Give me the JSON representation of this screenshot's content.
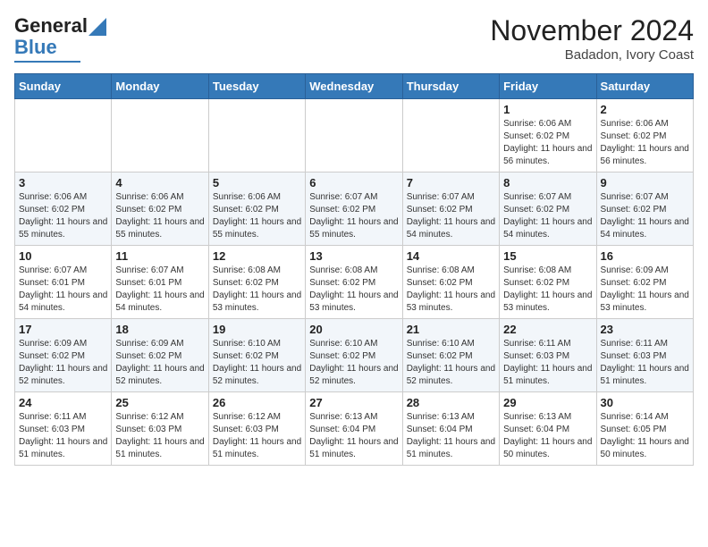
{
  "header": {
    "logo_line1": "General",
    "logo_line2": "Blue",
    "month_title": "November 2024",
    "location": "Badadon, Ivory Coast"
  },
  "weekdays": [
    "Sunday",
    "Monday",
    "Tuesday",
    "Wednesday",
    "Thursday",
    "Friday",
    "Saturday"
  ],
  "weeks": [
    [
      {
        "day": "",
        "info": ""
      },
      {
        "day": "",
        "info": ""
      },
      {
        "day": "",
        "info": ""
      },
      {
        "day": "",
        "info": ""
      },
      {
        "day": "",
        "info": ""
      },
      {
        "day": "1",
        "info": "Sunrise: 6:06 AM\nSunset: 6:02 PM\nDaylight: 11 hours and 56 minutes."
      },
      {
        "day": "2",
        "info": "Sunrise: 6:06 AM\nSunset: 6:02 PM\nDaylight: 11 hours and 56 minutes."
      }
    ],
    [
      {
        "day": "3",
        "info": "Sunrise: 6:06 AM\nSunset: 6:02 PM\nDaylight: 11 hours and 55 minutes."
      },
      {
        "day": "4",
        "info": "Sunrise: 6:06 AM\nSunset: 6:02 PM\nDaylight: 11 hours and 55 minutes."
      },
      {
        "day": "5",
        "info": "Sunrise: 6:06 AM\nSunset: 6:02 PM\nDaylight: 11 hours and 55 minutes."
      },
      {
        "day": "6",
        "info": "Sunrise: 6:07 AM\nSunset: 6:02 PM\nDaylight: 11 hours and 55 minutes."
      },
      {
        "day": "7",
        "info": "Sunrise: 6:07 AM\nSunset: 6:02 PM\nDaylight: 11 hours and 54 minutes."
      },
      {
        "day": "8",
        "info": "Sunrise: 6:07 AM\nSunset: 6:02 PM\nDaylight: 11 hours and 54 minutes."
      },
      {
        "day": "9",
        "info": "Sunrise: 6:07 AM\nSunset: 6:02 PM\nDaylight: 11 hours and 54 minutes."
      }
    ],
    [
      {
        "day": "10",
        "info": "Sunrise: 6:07 AM\nSunset: 6:01 PM\nDaylight: 11 hours and 54 minutes."
      },
      {
        "day": "11",
        "info": "Sunrise: 6:07 AM\nSunset: 6:01 PM\nDaylight: 11 hours and 54 minutes."
      },
      {
        "day": "12",
        "info": "Sunrise: 6:08 AM\nSunset: 6:02 PM\nDaylight: 11 hours and 53 minutes."
      },
      {
        "day": "13",
        "info": "Sunrise: 6:08 AM\nSunset: 6:02 PM\nDaylight: 11 hours and 53 minutes."
      },
      {
        "day": "14",
        "info": "Sunrise: 6:08 AM\nSunset: 6:02 PM\nDaylight: 11 hours and 53 minutes."
      },
      {
        "day": "15",
        "info": "Sunrise: 6:08 AM\nSunset: 6:02 PM\nDaylight: 11 hours and 53 minutes."
      },
      {
        "day": "16",
        "info": "Sunrise: 6:09 AM\nSunset: 6:02 PM\nDaylight: 11 hours and 53 minutes."
      }
    ],
    [
      {
        "day": "17",
        "info": "Sunrise: 6:09 AM\nSunset: 6:02 PM\nDaylight: 11 hours and 52 minutes."
      },
      {
        "day": "18",
        "info": "Sunrise: 6:09 AM\nSunset: 6:02 PM\nDaylight: 11 hours and 52 minutes."
      },
      {
        "day": "19",
        "info": "Sunrise: 6:10 AM\nSunset: 6:02 PM\nDaylight: 11 hours and 52 minutes."
      },
      {
        "day": "20",
        "info": "Sunrise: 6:10 AM\nSunset: 6:02 PM\nDaylight: 11 hours and 52 minutes."
      },
      {
        "day": "21",
        "info": "Sunrise: 6:10 AM\nSunset: 6:02 PM\nDaylight: 11 hours and 52 minutes."
      },
      {
        "day": "22",
        "info": "Sunrise: 6:11 AM\nSunset: 6:03 PM\nDaylight: 11 hours and 51 minutes."
      },
      {
        "day": "23",
        "info": "Sunrise: 6:11 AM\nSunset: 6:03 PM\nDaylight: 11 hours and 51 minutes."
      }
    ],
    [
      {
        "day": "24",
        "info": "Sunrise: 6:11 AM\nSunset: 6:03 PM\nDaylight: 11 hours and 51 minutes."
      },
      {
        "day": "25",
        "info": "Sunrise: 6:12 AM\nSunset: 6:03 PM\nDaylight: 11 hours and 51 minutes."
      },
      {
        "day": "26",
        "info": "Sunrise: 6:12 AM\nSunset: 6:03 PM\nDaylight: 11 hours and 51 minutes."
      },
      {
        "day": "27",
        "info": "Sunrise: 6:13 AM\nSunset: 6:04 PM\nDaylight: 11 hours and 51 minutes."
      },
      {
        "day": "28",
        "info": "Sunrise: 6:13 AM\nSunset: 6:04 PM\nDaylight: 11 hours and 51 minutes."
      },
      {
        "day": "29",
        "info": "Sunrise: 6:13 AM\nSunset: 6:04 PM\nDaylight: 11 hours and 50 minutes."
      },
      {
        "day": "30",
        "info": "Sunrise: 6:14 AM\nSunset: 6:05 PM\nDaylight: 11 hours and 50 minutes."
      }
    ]
  ]
}
